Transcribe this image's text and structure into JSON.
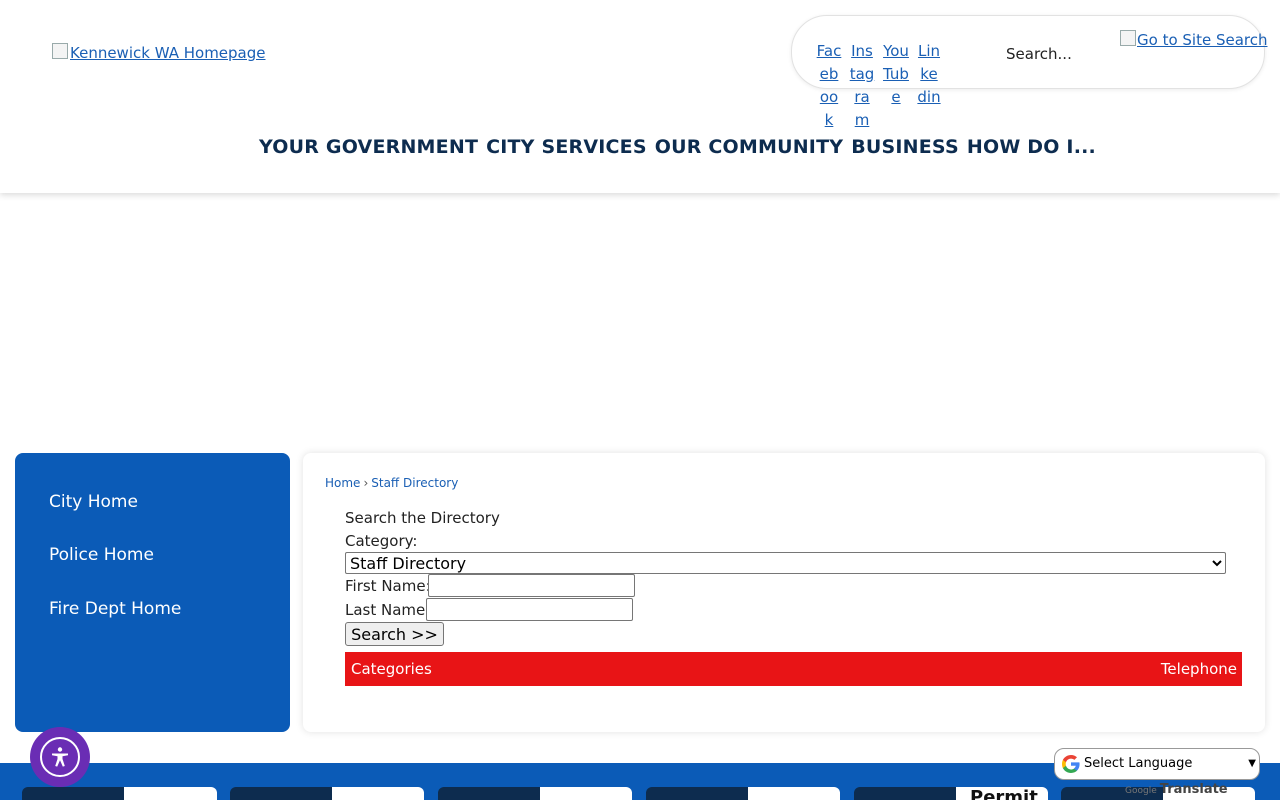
{
  "header": {
    "logo_alt": "Kennewick WA Homepage",
    "social": [
      {
        "label": "Facebook"
      },
      {
        "label": "Instagram"
      },
      {
        "label": "YouTube"
      },
      {
        "label": "Linkedin"
      }
    ],
    "search_placeholder": "Search...",
    "site_search_label": "Go to Site Search"
  },
  "nav": {
    "items": [
      "YOUR GOVERNMENT",
      "CITY SERVICES",
      "OUR COMMUNITY",
      "BUSINESS",
      "HOW DO I..."
    ]
  },
  "sidebar": {
    "items": [
      "City Home",
      "Police Home",
      "Fire Dept Home"
    ]
  },
  "breadcrumb": {
    "home": "Home",
    "separator": "›",
    "current": "Staff Directory"
  },
  "directory": {
    "heading": "Search the Directory",
    "category_label": "Category:",
    "category_selected": "Staff Directory",
    "first_name_label": "First Name:",
    "last_name_label": "Last Name:",
    "search_button": "Search >>",
    "columns": [
      "Categories",
      "Telephone"
    ]
  },
  "footer": {
    "partial_text": "Permit"
  },
  "translate": {
    "label": "Select Language",
    "powered_by": "Google",
    "action": "Translate"
  },
  "colors": {
    "brand_blue": "#0b5bb7",
    "nav_navy": "#0d2c4f",
    "table_red": "#e81416",
    "a11y_purple": "#6a2db4"
  }
}
